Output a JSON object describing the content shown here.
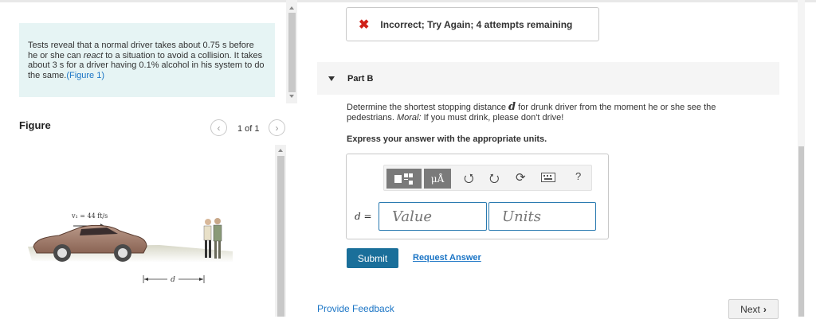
{
  "intro": {
    "text_before_react": "Tests reveal that a normal driver takes about 0.75 s before he or she can ",
    "react_word": "react",
    "text_after_react": " to a situation to avoid a collision. It takes about 3 s for a driver having 0.1% alcohol in his system to do the same.",
    "figure_link": "(Figure 1)"
  },
  "figure": {
    "title": "Figure",
    "pager": "1 of 1",
    "velocity_label": "v₁ = 44 ft/s",
    "distance_label": "d"
  },
  "feedback": {
    "message": "Incorrect; Try Again; 4 attempts remaining"
  },
  "part": {
    "label": "Part B"
  },
  "question": {
    "text_before_var": "Determine the shortest stopping distance ",
    "var": "d",
    "text_after_var": " for drunk driver from the moment he or she see the pedestrians. ",
    "moral_label": "Moral:",
    "moral_text": " If you must drink, please don't drive!",
    "express": "Express your answer with the appropriate units."
  },
  "toolbar": {
    "units_button": "μÅ",
    "help": "?"
  },
  "answer": {
    "label_var": "d",
    "label_eq": " =",
    "value_placeholder": "Value",
    "units_placeholder": "Units"
  },
  "actions": {
    "submit": "Submit",
    "request_answer": "Request Answer",
    "provide_feedback": "Provide Feedback",
    "next": "Next"
  },
  "colors": {
    "accent": "#1a6f9a",
    "link": "#1a74c5",
    "error": "#d0221a",
    "intro_bg": "#e6f4f4"
  }
}
